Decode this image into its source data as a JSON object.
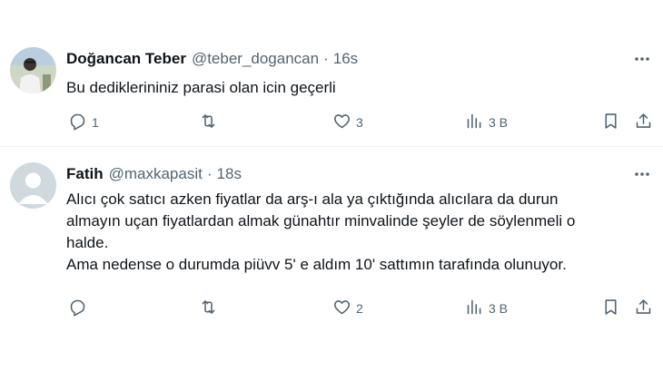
{
  "tweets": [
    {
      "name": "Doğancan Teber",
      "handle": "@teber_dogancan",
      "separator": "·",
      "time": "16s",
      "lines": [
        "Bu dediklerininiz parasi olan icin geçerli"
      ],
      "replies": "1",
      "retweets": "",
      "likes": "3",
      "views": "3 B"
    },
    {
      "name": "Fatih",
      "handle": "@maxkapasit",
      "separator": "·",
      "time": "18s",
      "lines": [
        "Alıcı çok satıcı azken fiyatlar da arş-ı ala ya çıktığında alıcılara da durun",
        "almayın uçan fiyatlardan almak günahtır minvalinde şeyler de söylenmeli o",
        "halde.",
        "Ama nedense o durumda piüvv 5' e aldım 10' sattımın tarafında olunuyor."
      ],
      "replies": "",
      "retweets": "",
      "likes": "2",
      "views": "3 B"
    }
  ],
  "colors": {
    "text": "#0f1419",
    "secondary": "#536471",
    "divider": "#eff3f4",
    "default_avatar_bg": "#cfd9de"
  },
  "icons": [
    "more-icon",
    "reply-icon",
    "retweet-icon",
    "like-icon",
    "views-icon",
    "bookmark-icon",
    "share-icon",
    "default-avatar-icon"
  ]
}
